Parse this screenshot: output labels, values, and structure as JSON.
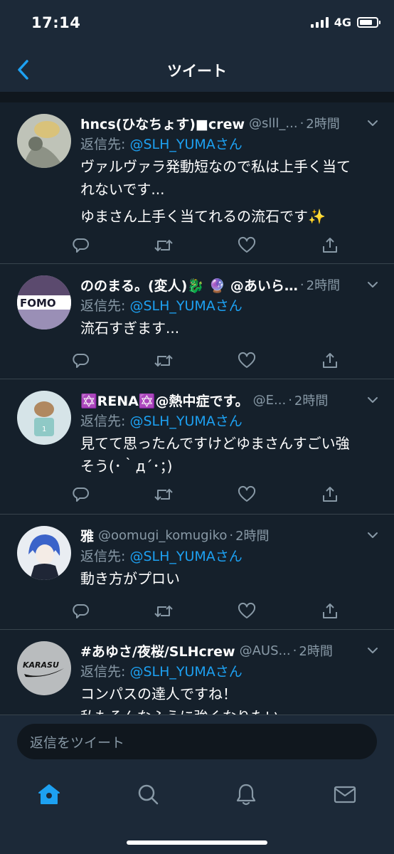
{
  "status_bar": {
    "time": "17:14",
    "network": "4G",
    "battery_level": 0.75
  },
  "nav": {
    "title": "ツイート"
  },
  "reply_prefix": "返信先:",
  "tweets": [
    {
      "display_name": "hncs(ひなちょす)■crew",
      "handle": "@slll_...",
      "time": "2時間",
      "reply_mention": "@SLH_YUMAさん",
      "lines": [
        "ヴァルヴァラ発動短なので私は上手く当て",
        "れないです...",
        "ゆまさん上手く当てれるの流石です✨"
      ],
      "avatar_color": "#bfc3b8"
    },
    {
      "display_name": "ののまる。(変人)🐉 🔮 @あいら…",
      "handle": "",
      "time": "2時間",
      "reply_mention": "@SLH_YUMAさん",
      "lines": [
        "流石すぎます..."
      ],
      "avatar_color": "#d8d2ea",
      "avatar_text": "FOMO"
    },
    {
      "display_name": "✡️RENA✡️@熱中症です。",
      "handle": "@E...",
      "time": "2時間",
      "reply_mention": "@SLH_YUMAさん",
      "lines": [
        "見てて思ったんですけどゆまさんすごい強",
        "そう(･｀д´･；)"
      ],
      "avatar_color": "#d6e4e8"
    },
    {
      "display_name": "雅",
      "handle": "@oomugi_komugiko",
      "time": "2時間",
      "reply_mention": "@SLH_YUMAさん",
      "lines": [
        "動き方がプロい"
      ],
      "avatar_color": "#e9edf2"
    },
    {
      "display_name": "#あゆさ/夜桜/SLHcrew",
      "handle": "@AUS...",
      "time": "2時間",
      "reply_mention": "@SLH_YUMAさん",
      "lines": [
        "コンパスの達人ですね！",
        "私もそんなふうに強くなりたい..."
      ],
      "avatar_color": "#b9bcbe",
      "avatar_text": "KARASU"
    }
  ],
  "compose": {
    "placeholder": "返信をツイート"
  },
  "colors": {
    "accent": "#1da1f2",
    "background": "#15202b",
    "bar": "#1c2938",
    "muted": "#8899a6",
    "divider": "#38444d"
  }
}
